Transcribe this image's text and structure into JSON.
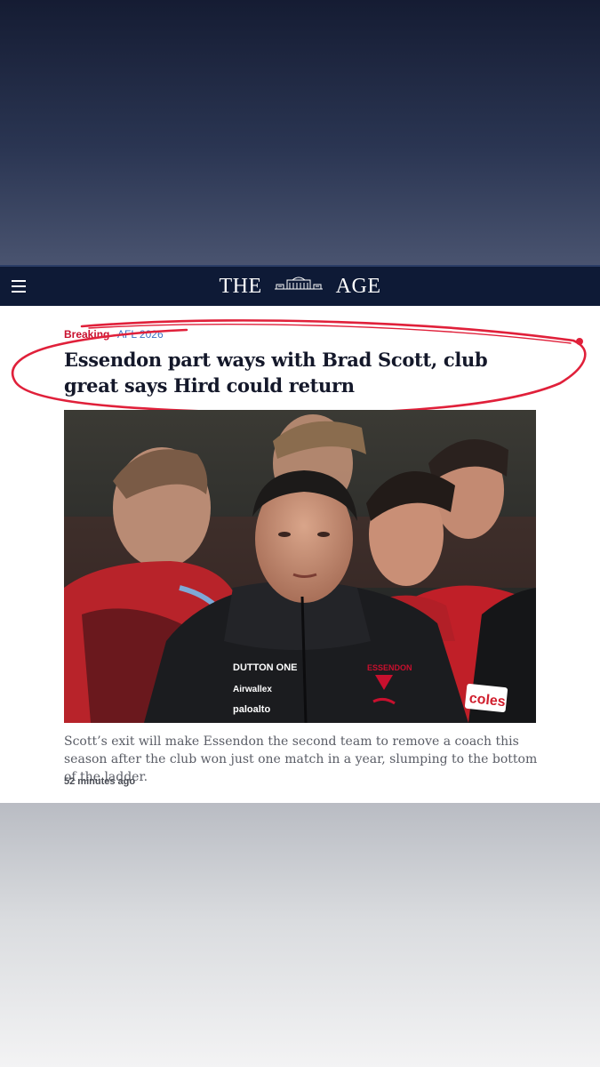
{
  "masthead": {
    "logo_left": "THE",
    "logo_right": "AGE",
    "menu_icon": "hamburger-menu-icon"
  },
  "article": {
    "kicker_breaking": "Breaking",
    "kicker_section": "AFL 2026",
    "headline": "Essendon part ways with Brad Scott, club great says Hird could return",
    "caption": "Scott’s exit will make Essendon the second team to remove a coach this season after the club won just one match in a year, slumping to the bottom of the ladder.",
    "timestamp": "52 minutes ago"
  },
  "photo": {
    "sponsors": [
      "DUTTON ONE",
      "Airwallex",
      "paloalto",
      "ESSENDON",
      "coles"
    ]
  },
  "colors": {
    "masthead": "#0e1a36",
    "breaking": "#c8102e",
    "section": "#3d72c4",
    "annotation": "#e0203a"
  }
}
